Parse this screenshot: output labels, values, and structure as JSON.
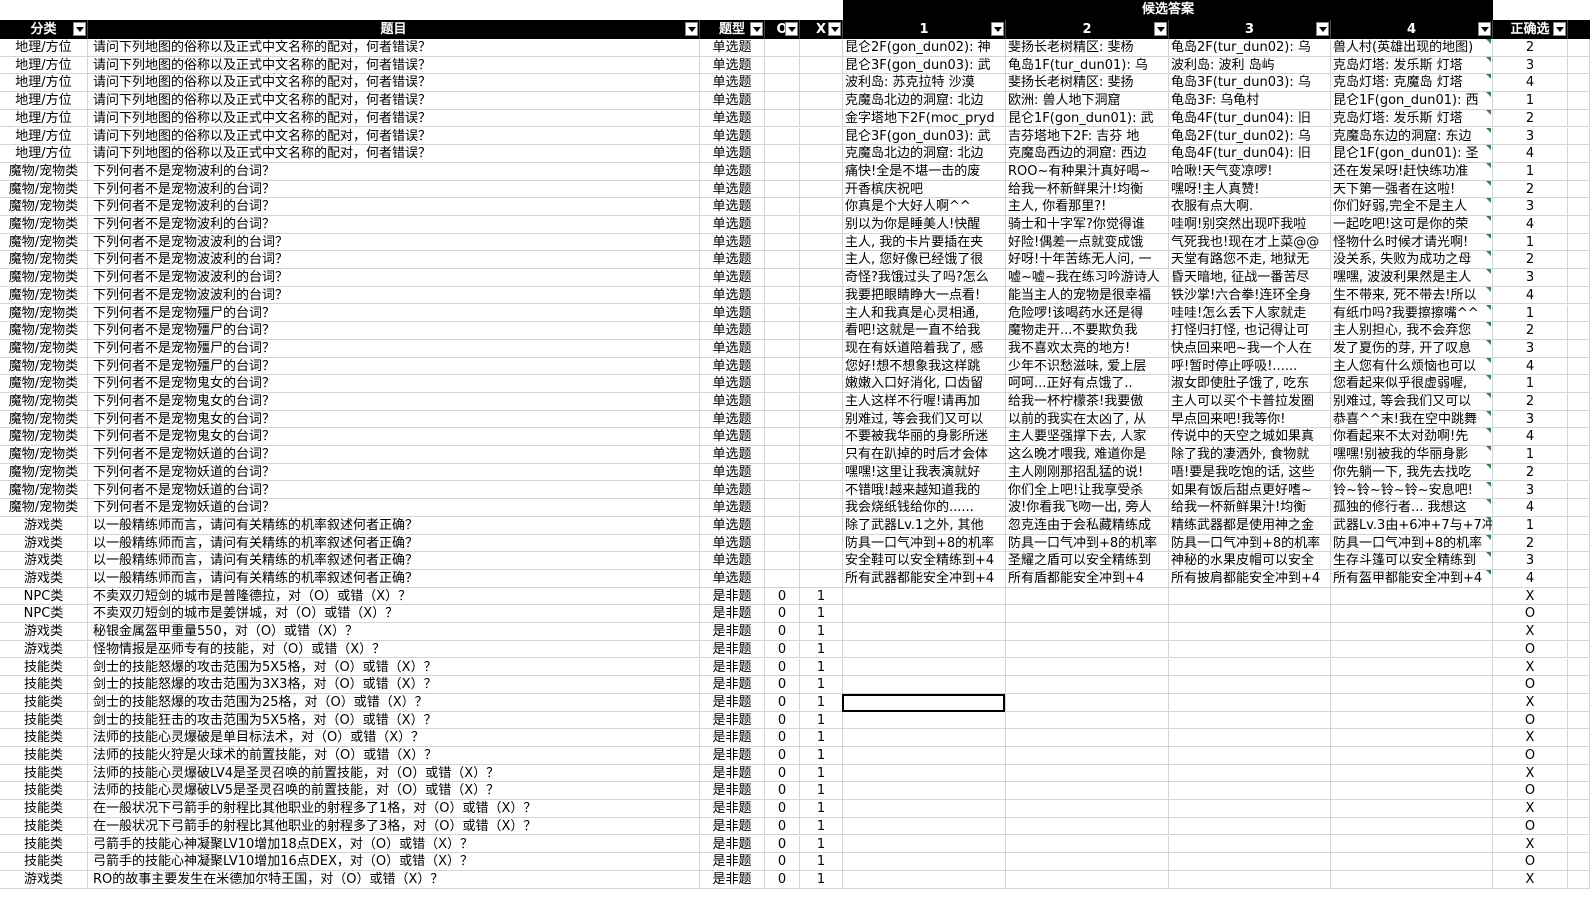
{
  "group_header": "候选答案",
  "columns": {
    "category": "分类",
    "question": "题目",
    "type": "题型",
    "o": "O",
    "x": "X",
    "a1": "1",
    "a2": "2",
    "a3": "3",
    "a4": "4",
    "answer": "正确选"
  },
  "rows": [
    {
      "cat": "地理/方位",
      "q": "请问下列地图的俗称以及正式中文名称的配对，何者错误？",
      "type": "单选题",
      "o": "",
      "x": "",
      "a1": "昆仑2F(gon_dun02): 神",
      "a2": "斐扬长老树精区: 斐杨",
      "a3": "龟岛2F(tur_dun02): 乌",
      "a4": "兽人村(英雄出现的地图)",
      "ans": "2"
    },
    {
      "cat": "地理/方位",
      "q": "请问下列地图的俗称以及正式中文名称的配对，何者错误？",
      "type": "单选题",
      "o": "",
      "x": "",
      "a1": "昆仑3F(gon_dun03): 武",
      "a2": "龟岛1F(tur_dun01): 乌",
      "a3": "波利岛: 波利 岛屿",
      "a4": "克岛灯塔: 发乐斯 灯塔",
      "ans": "3"
    },
    {
      "cat": "地理/方位",
      "q": "请问下列地图的俗称以及正式中文名称的配对，何者错误？",
      "type": "单选题",
      "o": "",
      "x": "",
      "a1": "波利岛: 苏克拉特 沙漠",
      "a2": "斐扬长老树精区: 斐扬",
      "a3": "龟岛3F(tur_dun03): 乌",
      "a4": "克岛灯塔: 克魔岛 灯塔",
      "ans": "4"
    },
    {
      "cat": "地理/方位",
      "q": "请问下列地图的俗称以及正式中文名称的配对，何者错误？",
      "type": "单选题",
      "o": "",
      "x": "",
      "a1": "克魔岛北边的洞窟: 北边",
      "a2": "欧洲: 兽人地下洞窟",
      "a3": "龟岛3F: 乌龟村",
      "a4": "昆仑1F(gon_dun01): 西",
      "ans": "1"
    },
    {
      "cat": "地理/方位",
      "q": "请问下列地图的俗称以及正式中文名称的配对，何者错误？",
      "type": "单选题",
      "o": "",
      "x": "",
      "a1": "金字塔地下2F(moc_pryd",
      "a2": "昆仑1F(gon_dun01): 武",
      "a3": "龟岛4F(tur_dun04): 旧",
      "a4": "克岛灯塔: 发乐斯 灯塔",
      "ans": "2"
    },
    {
      "cat": "地理/方位",
      "q": "请问下列地图的俗称以及正式中文名称的配对，何者错误？",
      "type": "单选题",
      "o": "",
      "x": "",
      "a1": "昆仑3F(gon_dun03): 武",
      "a2": "吉芬塔地下2F: 吉芬 地",
      "a3": "龟岛2F(tur_dun02): 乌",
      "a4": "克魔岛东边的洞窟: 东边",
      "ans": "3"
    },
    {
      "cat": "地理/方位",
      "q": "请问下列地图的俗称以及正式中文名称的配对，何者错误？",
      "type": "单选题",
      "o": "",
      "x": "",
      "a1": "克魔岛北边的洞窟: 北边",
      "a2": "克魔岛西边的洞窟: 西边",
      "a3": "龟岛4F(tur_dun04): 旧",
      "a4": "昆仑1F(gon_dun01): 圣",
      "ans": "4"
    },
    {
      "cat": "魔物/宠物类",
      "q": "下列何者不是宠物波利的台词？",
      "type": "单选题",
      "o": "",
      "x": "",
      "a1": "痛快!全是不堪一击的废",
      "a2": "ROO~有种果汁真好喝~",
      "a3": "哈啾!天气变凉啰!",
      "a4": "还在发呆呀!赶快练功准",
      "ans": "1"
    },
    {
      "cat": "魔物/宠物类",
      "q": "下列何者不是宠物波利的台词？",
      "type": "单选题",
      "o": "",
      "x": "",
      "a1": "开香槟庆祝吧",
      "a2": "给我一杯新鲜果汁!均衡",
      "a3": "嘿呀!主人真赞!",
      "a4": "天下第一强者在这啦!",
      "ans": "2"
    },
    {
      "cat": "魔物/宠物类",
      "q": "下列何者不是宠物波利的台词？",
      "type": "单选题",
      "o": "",
      "x": "",
      "a1": "你真是个大好人啊^^",
      "a2": "主人, 你看那里?!",
      "a3": "衣服有点大啊.",
      "a4": "你们好弱,完全不是主人",
      "ans": "3"
    },
    {
      "cat": "魔物/宠物类",
      "q": "下列何者不是宠物波利的台词？",
      "type": "单选题",
      "o": "",
      "x": "",
      "a1": "别以为你是睡美人!快醒",
      "a2": "骑士和十字军?你觉得谁",
      "a3": "哇啊!别突然出现吓我啦",
      "a4": "一起吃吧!这可是你的荣",
      "ans": "4"
    },
    {
      "cat": "魔物/宠物类",
      "q": "下列何者不是宠物波波利的台词？",
      "type": "单选题",
      "o": "",
      "x": "",
      "a1": "主人, 我的卡片要插在夹",
      "a2": "好险!偶差一点就变成饿",
      "a3": "气死我也!现在才上菜@@",
      "a4": "怪物什么时候才请光啊!",
      "ans": "1"
    },
    {
      "cat": "魔物/宠物类",
      "q": "下列何者不是宠物波波利的台词？",
      "type": "单选题",
      "o": "",
      "x": "",
      "a1": "主人, 您好像已经饿了很",
      "a2": "好呀!十年苦练无人问, 一",
      "a3": "天堂有路您不走, 地狱无",
      "a4": "没关系, 失败为成功之母",
      "ans": "2"
    },
    {
      "cat": "魔物/宠物类",
      "q": "下列何者不是宠物波波利的台词？",
      "type": "单选题",
      "o": "",
      "x": "",
      "a1": "奇怪?我饿过头了吗?怎么",
      "a2": "嘘~嘘~我在练习吟游诗人",
      "a3": "昏天暗地, 征战一番苦尽",
      "a4": "嘿嘿, 波波利果然是主人",
      "ans": "3"
    },
    {
      "cat": "魔物/宠物类",
      "q": "下列何者不是宠物波波利的台词？",
      "type": "单选题",
      "o": "",
      "x": "",
      "a1": "我要把眼睛睁大一点看!",
      "a2": "能当主人的宠物是很幸福",
      "a3": "铁沙掌!六合拳!连环全身",
      "a4": "生不带来, 死不带去!所以",
      "ans": "4"
    },
    {
      "cat": "魔物/宠物类",
      "q": "下列何者不是宠物殭尸的台词？",
      "type": "单选题",
      "o": "",
      "x": "",
      "a1": "主人和我真是心灵相通,",
      "a2": "危险啰!该喝药水还是得",
      "a3": "哇哇!怎么丢下人家就走",
      "a4": "有纸巾吗?我要擦擦嘴^^",
      "ans": "1"
    },
    {
      "cat": "魔物/宠物类",
      "q": "下列何者不是宠物殭尸的台词？",
      "type": "单选题",
      "o": "",
      "x": "",
      "a1": "看吧!这就是一直不给我",
      "a2": "魔物走开...不要欺负我",
      "a3": "打怪归打怪, 也记得让可",
      "a4": "主人别担心, 我不会弃您",
      "ans": "2"
    },
    {
      "cat": "魔物/宠物类",
      "q": "下列何者不是宠物殭尸的台词？",
      "type": "单选题",
      "o": "",
      "x": "",
      "a1": "现在有妖道陪着我了, 感",
      "a2": "我不喜欢太亮的地方!",
      "a3": "快点回来吧~我一个人在",
      "a4": "发了夏伤的芽, 开了叹息",
      "ans": "3"
    },
    {
      "cat": "魔物/宠物类",
      "q": "下列何者不是宠物殭尸的台词？",
      "type": "单选题",
      "o": "",
      "x": "",
      "a1": "您好!想不想象我这样跳",
      "a2": "少年不识愁滋味, 爱上层",
      "a3": "呼!暂时停止呼吸!......",
      "a4": "主人您有什么烦恼也可以",
      "ans": "4"
    },
    {
      "cat": "魔物/宠物类",
      "q": "下列何者不是宠物鬼女的台词？",
      "type": "单选题",
      "o": "",
      "x": "",
      "a1": "嫩嫩入口好消化, 口齿留",
      "a2": "呵呵...正好有点饿了..",
      "a3": "淑女即使肚子饿了, 吃东",
      "a4": "您看起来似乎很虚弱喔,",
      "ans": "1"
    },
    {
      "cat": "魔物/宠物类",
      "q": "下列何者不是宠物鬼女的台词？",
      "type": "单选题",
      "o": "",
      "x": "",
      "a1": "主人这样不行喔!请再加",
      "a2": "给我一杯柠檬茶!我要傲",
      "a3": "主人可以买个卡普拉发圈",
      "a4": "别难过, 等会我们又可以",
      "ans": "2"
    },
    {
      "cat": "魔物/宠物类",
      "q": "下列何者不是宠物鬼女的台词？",
      "type": "单选题",
      "o": "",
      "x": "",
      "a1": "别难过, 等会我们又可以",
      "a2": "以前的我实在太凶了, 从",
      "a3": "早点回来吧!我等你!",
      "a4": "恭喜^^末!我在空中跳舞",
      "ans": "3"
    },
    {
      "cat": "魔物/宠物类",
      "q": "下列何者不是宠物鬼女的台词？",
      "type": "单选题",
      "o": "",
      "x": "",
      "a1": "不要被我华丽的身影所迷",
      "a2": "主人要坚强撑下去, 人家",
      "a3": "传说中的天空之城如果真",
      "a4": "你看起来不太对劲啊!先",
      "ans": "4"
    },
    {
      "cat": "魔物/宠物类",
      "q": "下列何者不是宠物妖道的台词？",
      "type": "单选题",
      "o": "",
      "x": "",
      "a1": "只有在趴掉的时后才会体",
      "a2": "这么晚才喂我, 难道你是",
      "a3": "除了我的凄洒外, 食物就",
      "a4": "嘿嘿!别被我的华丽身影",
      "ans": "1"
    },
    {
      "cat": "魔物/宠物类",
      "q": "下列何者不是宠物妖道的台词？",
      "type": "单选题",
      "o": "",
      "x": "",
      "a1": "嘿嘿!这里让我表演就好",
      "a2": "主人刚刚那招乱猛的说!",
      "a3": "唔!要是我吃饱的话, 这些",
      "a4": "你先躺一下, 我先去找吃",
      "ans": "2"
    },
    {
      "cat": "魔物/宠物类",
      "q": "下列何者不是宠物妖道的台词？",
      "type": "单选题",
      "o": "",
      "x": "",
      "a1": "不错哦!越来越知道我的",
      "a2": "你们全上吧!让我享受杀",
      "a3": "如果有饭后甜点更好嗜~",
      "a4": "铃~铃~铃~铃~安息吧!",
      "ans": "3"
    },
    {
      "cat": "魔物/宠物类",
      "q": "下列何者不是宠物妖道的台词？",
      "type": "单选题",
      "o": "",
      "x": "",
      "a1": "我会烧纸钱给你的......",
      "a2": "波!你看我飞吻一出, 旁人",
      "a3": "给我一杯新鲜果汁!均衡",
      "a4": "孤独的修行者... 我想这",
      "ans": "4"
    },
    {
      "cat": "游戏类",
      "q": "以一般精练师而言，请问有关精练的机率叙述何者正确？",
      "type": "单选题",
      "o": "",
      "x": "",
      "a1": "除了武器Lv.1之外, 其他",
      "a2": "忽克连由于会私藏精练成",
      "a3": "精练武器都是使用神之金",
      "a4": "武器Lv.3由+6冲+7与+7冲",
      "ans": "1"
    },
    {
      "cat": "游戏类",
      "q": "以一般精练师而言，请问有关精练的机率叙述何者正确？",
      "type": "单选题",
      "o": "",
      "x": "",
      "a1": "防具一口气冲到+8的机率",
      "a2": "防具一口气冲到+8的机率",
      "a3": "防具一口气冲到+8的机率",
      "a4": "防具一口气冲到+8的机率",
      "ans": "2"
    },
    {
      "cat": "游戏类",
      "q": "以一般精练师而言，请问有关精练的机率叙述何者正确？",
      "type": "单选题",
      "o": "",
      "x": "",
      "a1": "安全鞋可以安全精练到+4",
      "a2": "圣耀之盾可以安全精练到",
      "a3": "神秘的水果皮帽可以安全",
      "a4": "生存斗篷可以安全精练到",
      "ans": "3"
    },
    {
      "cat": "游戏类",
      "q": "以一般精练师而言，请问有关精练的机率叙述何者正确？",
      "type": "单选题",
      "o": "",
      "x": "",
      "a1": "所有武器都能安全冲到+4",
      "a2": "所有盾都能安全冲到+4",
      "a3": "所有披肩都能安全冲到+4",
      "a4": "所有盔甲都能安全冲到+4",
      "ans": "4"
    },
    {
      "cat": "NPC类",
      "q": "不卖双刃短剑的城市是普隆德拉，对（O）或错（X）？",
      "type": "是非题",
      "o": "0",
      "x": "1",
      "a1": "",
      "a2": "",
      "a3": "",
      "a4": "",
      "ans": "X"
    },
    {
      "cat": "NPC类",
      "q": "不卖双刃短剑的城市是姜饼城，对（O）或错（X）？",
      "type": "是非题",
      "o": "0",
      "x": "1",
      "a1": "",
      "a2": "",
      "a3": "",
      "a4": "",
      "ans": "O"
    },
    {
      "cat": "游戏类",
      "q": "秘银金属盔甲重量550，对（O）或错（X）？",
      "type": "是非题",
      "o": "0",
      "x": "1",
      "a1": "",
      "a2": "",
      "a3": "",
      "a4": "",
      "ans": "X"
    },
    {
      "cat": "游戏类",
      "q": "怪物情报是巫师专有的技能，对（O）或错（X）？",
      "type": "是非题",
      "o": "0",
      "x": "1",
      "a1": "",
      "a2": "",
      "a3": "",
      "a4": "",
      "ans": "O"
    },
    {
      "cat": "技能类",
      "q": "剑士的技能怒爆的攻击范围为5X5格，对（O）或错（X）？",
      "type": "是非题",
      "o": "0",
      "x": "1",
      "a1": "",
      "a2": "",
      "a3": "",
      "a4": "",
      "ans": "X"
    },
    {
      "cat": "技能类",
      "q": "剑士的技能怒爆的攻击范围为3X3格，对（O）或错（X）？",
      "type": "是非题",
      "o": "0",
      "x": "1",
      "a1": "",
      "a2": "",
      "a3": "",
      "a4": "",
      "ans": "O"
    },
    {
      "cat": "技能类",
      "q": "剑士的技能怒爆的攻击范围为25格，对（O）或错（X）？",
      "type": "是非题",
      "o": "0",
      "x": "1",
      "a1": "",
      "a2": "",
      "a3": "",
      "a4": "",
      "ans": "X"
    },
    {
      "cat": "技能类",
      "q": "剑士的技能狂击的攻击范围为5X5格，对（O）或错（X）？",
      "type": "是非题",
      "o": "0",
      "x": "1",
      "a1": "",
      "a2": "",
      "a3": "",
      "a4": "",
      "ans": "O"
    },
    {
      "cat": "技能类",
      "q": "法师的技能心灵爆破是单目标法术，对（O）或错（X）？",
      "type": "是非题",
      "o": "0",
      "x": "1",
      "a1": "",
      "a2": "",
      "a3": "",
      "a4": "",
      "ans": "X"
    },
    {
      "cat": "技能类",
      "q": "法师的技能火狩是火球术的前置技能，对（O）或错（X）？",
      "type": "是非题",
      "o": "0",
      "x": "1",
      "a1": "",
      "a2": "",
      "a3": "",
      "a4": "",
      "ans": "O"
    },
    {
      "cat": "技能类",
      "q": "法师的技能心灵爆破LV4是圣灵召唤的前置技能，对（O）或错（X）？",
      "type": "是非题",
      "o": "0",
      "x": "1",
      "a1": "",
      "a2": "",
      "a3": "",
      "a4": "",
      "ans": "X"
    },
    {
      "cat": "技能类",
      "q": "法师的技能心灵爆破LV5是圣灵召唤的前置技能，对（O）或错（X）？",
      "type": "是非题",
      "o": "0",
      "x": "1",
      "a1": "",
      "a2": "",
      "a3": "",
      "a4": "",
      "ans": "O"
    },
    {
      "cat": "技能类",
      "q": "在一般状况下弓箭手的射程比其他职业的射程多了1格，对（O）或错（X）？",
      "type": "是非题",
      "o": "0",
      "x": "1",
      "a1": "",
      "a2": "",
      "a3": "",
      "a4": "",
      "ans": "X"
    },
    {
      "cat": "技能类",
      "q": "在一般状况下弓箭手的射程比其他职业的射程多了3格，对（O）或错（X）？",
      "type": "是非题",
      "o": "0",
      "x": "1",
      "a1": "",
      "a2": "",
      "a3": "",
      "a4": "",
      "ans": "O"
    },
    {
      "cat": "技能类",
      "q": "弓箭手的技能心神凝聚LV10增加18点DEX，对（O）或错（X）？",
      "type": "是非题",
      "o": "0",
      "x": "1",
      "a1": "",
      "a2": "",
      "a3": "",
      "a4": "",
      "ans": "X"
    },
    {
      "cat": "技能类",
      "q": "弓箭手的技能心神凝聚LV10增加16点DEX，对（O）或错（X）？",
      "type": "是非题",
      "o": "0",
      "x": "1",
      "a1": "",
      "a2": "",
      "a3": "",
      "a4": "",
      "ans": "O"
    },
    {
      "cat": "游戏类",
      "q": "RO的故事主要发生在米德加尔特王国，对（O）或错（X）？",
      "type": "是非题",
      "o": "0",
      "x": "1",
      "a1": "",
      "a2": "",
      "a3": "",
      "a4": "",
      "ans": "X"
    }
  ]
}
